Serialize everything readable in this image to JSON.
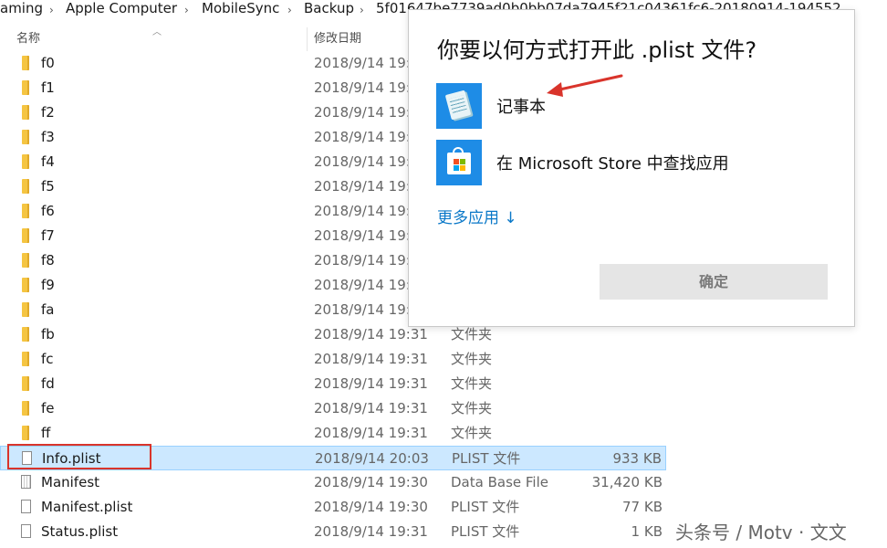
{
  "breadcrumb": {
    "items": [
      "aming",
      "Apple Computer",
      "MobileSync",
      "Backup",
      "5f01647be7739ad0b0bb07da7945f21c04361fc6-20180914-194552"
    ],
    "separator": "›"
  },
  "columns": {
    "name": "名称",
    "date": "修改日期"
  },
  "files": [
    {
      "name": "f0",
      "date": "2018/9/14 19:",
      "type": "",
      "size": "",
      "icon": "folder"
    },
    {
      "name": "f1",
      "date": "2018/9/14 19:",
      "type": "",
      "size": "",
      "icon": "folder"
    },
    {
      "name": "f2",
      "date": "2018/9/14 19:",
      "type": "",
      "size": "",
      "icon": "folder"
    },
    {
      "name": "f3",
      "date": "2018/9/14 19:",
      "type": "",
      "size": "",
      "icon": "folder"
    },
    {
      "name": "f4",
      "date": "2018/9/14 19:",
      "type": "",
      "size": "",
      "icon": "folder"
    },
    {
      "name": "f5",
      "date": "2018/9/14 19:",
      "type": "",
      "size": "",
      "icon": "folder"
    },
    {
      "name": "f6",
      "date": "2018/9/14 19:",
      "type": "",
      "size": "",
      "icon": "folder"
    },
    {
      "name": "f7",
      "date": "2018/9/14 19:",
      "type": "",
      "size": "",
      "icon": "folder"
    },
    {
      "name": "f8",
      "date": "2018/9/14 19:",
      "type": "",
      "size": "",
      "icon": "folder"
    },
    {
      "name": "f9",
      "date": "2018/9/14 19:",
      "type": "",
      "size": "",
      "icon": "folder"
    },
    {
      "name": "fa",
      "date": "2018/9/14 19:",
      "type": "",
      "size": "",
      "icon": "folder"
    },
    {
      "name": "fb",
      "date": "2018/9/14 19:31",
      "type": "文件夹",
      "size": "",
      "icon": "folder"
    },
    {
      "name": "fc",
      "date": "2018/9/14 19:31",
      "type": "文件夹",
      "size": "",
      "icon": "folder"
    },
    {
      "name": "fd",
      "date": "2018/9/14 19:31",
      "type": "文件夹",
      "size": "",
      "icon": "folder"
    },
    {
      "name": "fe",
      "date": "2018/9/14 19:31",
      "type": "文件夹",
      "size": "",
      "icon": "folder"
    },
    {
      "name": "ff",
      "date": "2018/9/14 19:31",
      "type": "文件夹",
      "size": "",
      "icon": "folder"
    },
    {
      "name": "Info.plist",
      "date": "2018/9/14 20:03",
      "type": "PLIST 文件",
      "size": "933 KB",
      "icon": "file",
      "selected": true
    },
    {
      "name": "Manifest",
      "date": "2018/9/14 19:30",
      "type": "Data Base File",
      "size": "31,420 KB",
      "icon": "db"
    },
    {
      "name": "Manifest.plist",
      "date": "2018/9/14 19:30",
      "type": "PLIST 文件",
      "size": "77 KB",
      "icon": "file"
    },
    {
      "name": "Status.plist",
      "date": "2018/9/14 19:31",
      "type": "PLIST 文件",
      "size": "1 KB",
      "icon": "file"
    }
  ],
  "dialog": {
    "title": "你要以何方式打开此 .plist 文件?",
    "apps": [
      {
        "label": "记事本",
        "icon": "notepad-icon"
      },
      {
        "label": "在 Microsoft Store 中查找应用",
        "icon": "store-icon"
      }
    ],
    "more_apps": "更多应用 ↓",
    "ok_label": "确定"
  },
  "colors": {
    "selection": "#cce8ff",
    "accent": "#0a78c8",
    "highlight_red": "#d9342b",
    "folder": "#f5c542"
  },
  "watermark": "头条号 / Motv · 文文"
}
